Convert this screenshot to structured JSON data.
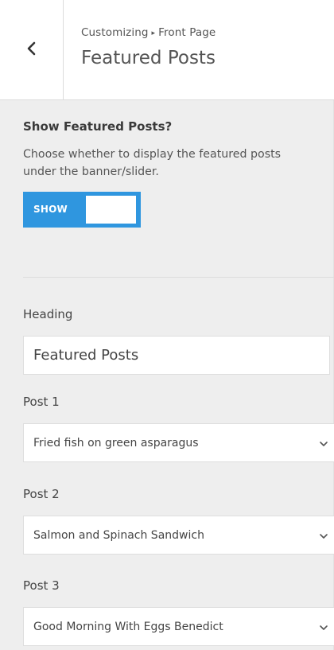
{
  "header": {
    "breadcrumb_root": "Customizing",
    "breadcrumb_separator": "▸",
    "breadcrumb_section": "Front Page",
    "title": "Featured Posts"
  },
  "show_featured": {
    "label": "Show Featured Posts?",
    "description": "Choose whether to display the featured posts under the banner/slider.",
    "toggle_label": "SHOW",
    "enabled": true
  },
  "heading": {
    "label": "Heading",
    "value": "Featured Posts"
  },
  "posts": [
    {
      "label": "Post 1",
      "selected": "Fried fish on green asparagus"
    },
    {
      "label": "Post 2",
      "selected": "Salmon and Spinach Sandwich"
    },
    {
      "label": "Post 3",
      "selected": "Good Morning With Eggs Benedict"
    }
  ],
  "colors": {
    "accent": "#2f96df",
    "panel_bg": "#eeeeee",
    "header_bg": "#ffffff"
  },
  "icons": {
    "back": "chevron-left-icon",
    "dropdown": "chevron-down-icon"
  }
}
